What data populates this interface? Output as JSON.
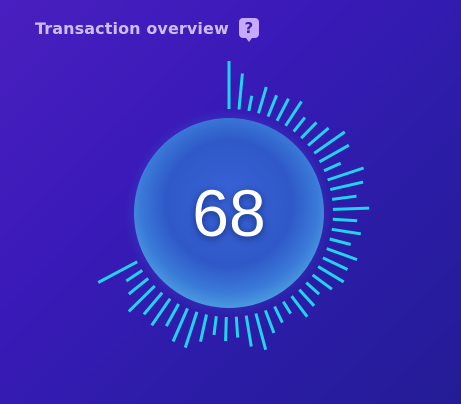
{
  "header": {
    "title": "Transaction overview",
    "help_icon": "question-icon",
    "help_label": "?"
  },
  "gauge": {
    "value": "68",
    "accent_color": "#22d3ee",
    "orb_color": "#2e6fd1"
  }
}
